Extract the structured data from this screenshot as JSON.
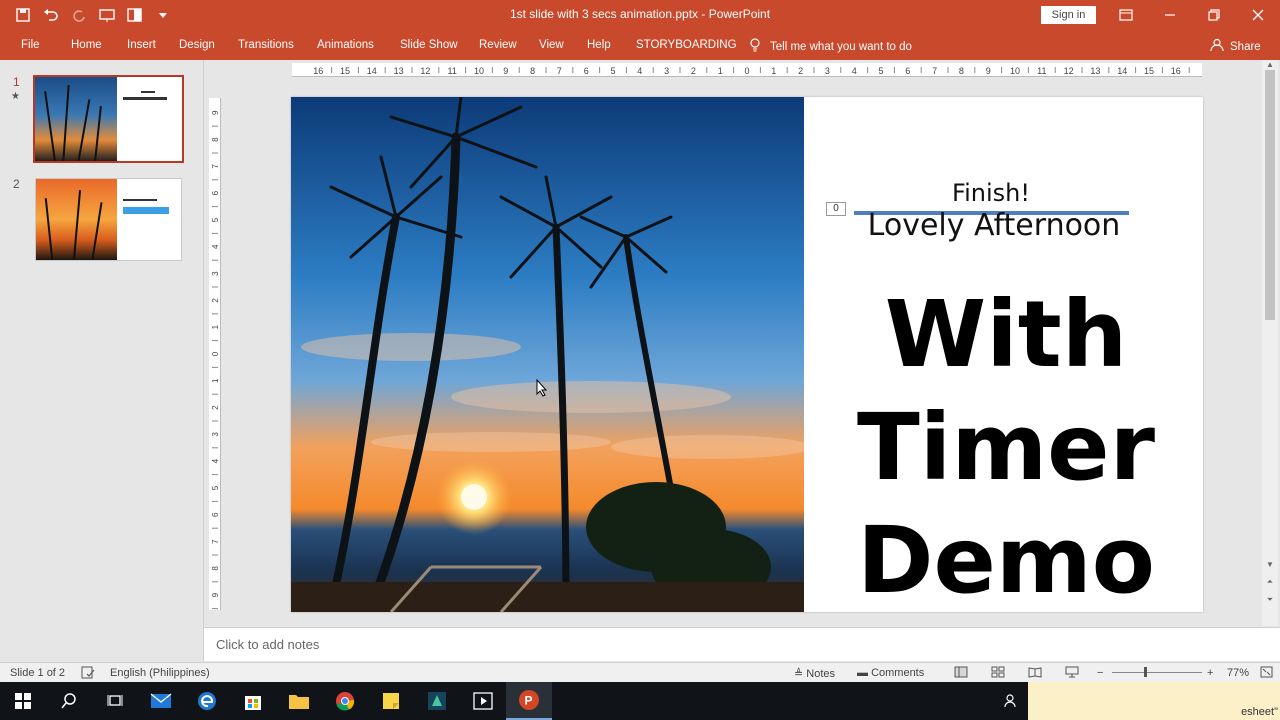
{
  "window": {
    "title": "1st slide with 3 secs animation.pptx - PowerPoint",
    "sign_in": "Sign in"
  },
  "ribbon": {
    "tabs": [
      "File",
      "Home",
      "Insert",
      "Design",
      "Transitions",
      "Animations",
      "Slide Show",
      "Review",
      "View",
      "Help",
      "STORYBOARDING"
    ],
    "tell_me": "Tell me what you want to do",
    "share": "Share"
  },
  "thumbnails": [
    {
      "number": "1",
      "star": "★",
      "selected": true
    },
    {
      "number": "2",
      "selected": false
    }
  ],
  "slide": {
    "finish_text": "Finish!",
    "title_text": "Lovely Afternoon",
    "animation_badge": "0",
    "big_lines": [
      "With",
      "Timer",
      "Demo"
    ]
  },
  "notes": {
    "placeholder": "Click to add notes"
  },
  "statusbar": {
    "slide_indicator": "Slide 1 of 2",
    "language": "English (Philippines)",
    "notes": "Notes",
    "comments": "Comments",
    "zoom_minus": "−",
    "zoom_plus": "+",
    "zoom": "77%"
  },
  "taskbar": {
    "tooltip_text": "esheet\""
  },
  "colors": {
    "accent": "#c8492b",
    "selection": "#b43a23",
    "underline": "#4f7fc0"
  }
}
